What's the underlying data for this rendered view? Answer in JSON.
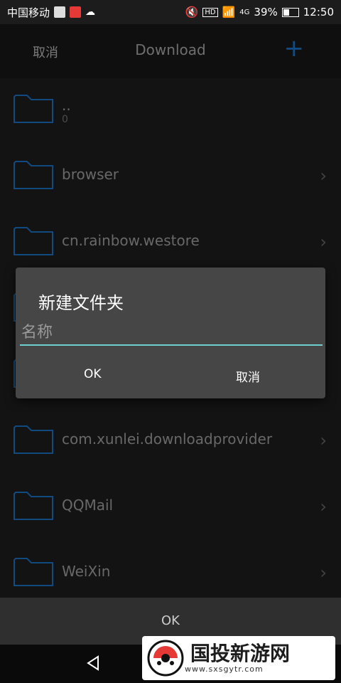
{
  "status_bar": {
    "carrier": "中国移动",
    "network": "4G",
    "battery": "39%",
    "time": "12:50"
  },
  "toolbar": {
    "cancel_label": "取消",
    "title": "Download",
    "add_icon": "plus-icon"
  },
  "files": [
    {
      "name": "..",
      "sub": "0"
    },
    {
      "name": "browser"
    },
    {
      "name": "cn.rainbow.westore"
    },
    {
      "name": "com.xunlei.downloadprovider"
    },
    {
      "name": "QQMail"
    },
    {
      "name": "WeiXin"
    }
  ],
  "dialog": {
    "title": "新建文件夹",
    "input_placeholder": "名称",
    "input_value": "",
    "ok_label": "OK",
    "cancel_label": "取消"
  },
  "footer": {
    "ok_label": "OK"
  },
  "watermark": {
    "text": "国投新游网",
    "url": "www.sxsgytr.com"
  },
  "colors": {
    "accent": "#1e88e5",
    "input_underline": "#6fd0d0",
    "folder_outline": "#1e88e5"
  }
}
